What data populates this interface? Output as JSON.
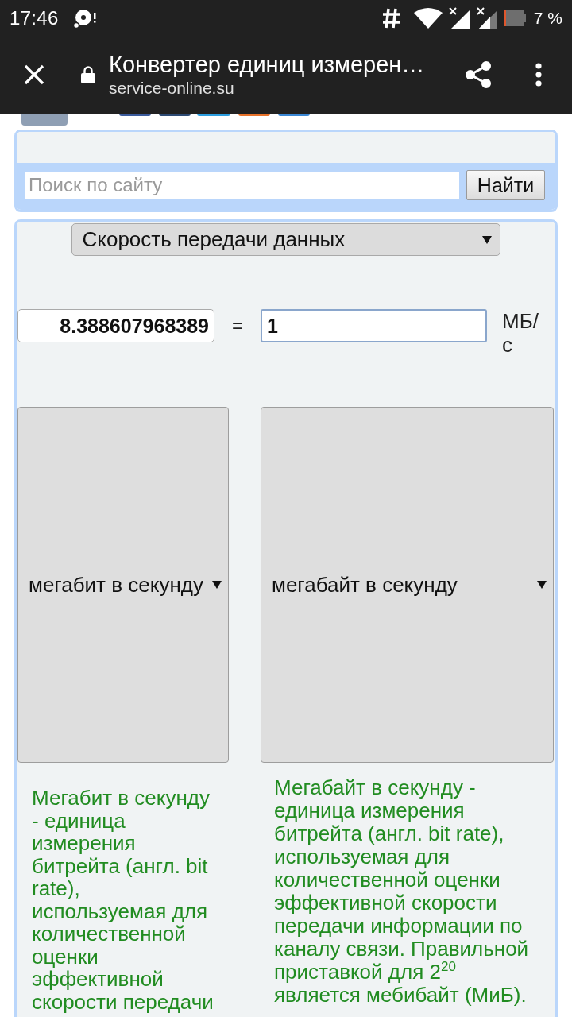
{
  "status_bar": {
    "time": "17:46",
    "battery": "7 %"
  },
  "browser_bar": {
    "title": "Конвертер единиц измерен…",
    "url": "service-online.su"
  },
  "search": {
    "placeholder": "Поиск по сайту",
    "button": "Найти"
  },
  "converter": {
    "category": "Скорость передачи данных",
    "from": {
      "value": "8.388607968389",
      "focused": false
    },
    "equals": "=",
    "to": {
      "value": "1",
      "focused": true
    },
    "unit_label": "МБ/с",
    "units": [
      {
        "name": "мегабит в секунду",
        "description": "Мегабит в секунду - единица измерения битрейта (англ. bit rate), используемая для количественной оценки эффективной скорости передачи"
      },
      {
        "name": "мегабайт в секунду",
        "description": "Мегабайт в секунду - единица измерения битрейта (англ. bit rate), используемая для количественной оценки эффективной скорости передачи информации по каналу связи. Правильной приставкой для 2$^{20}$ является мебибайт (МиБ)."
      }
    ]
  }
}
